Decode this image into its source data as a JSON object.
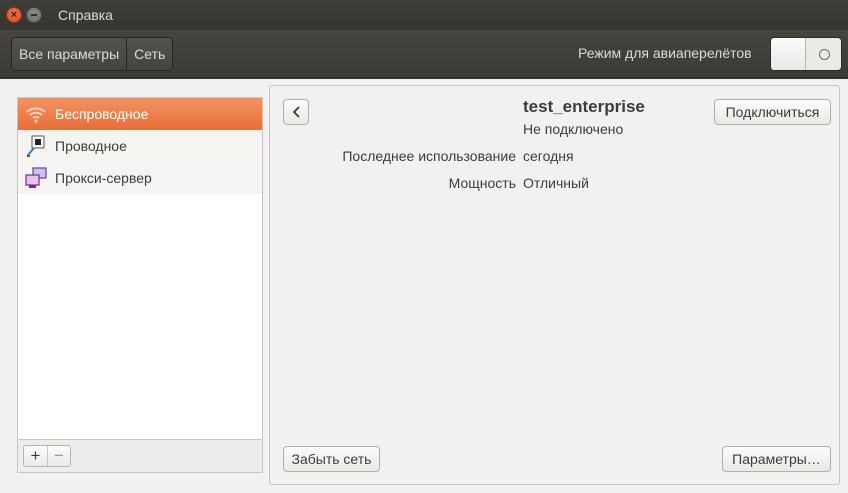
{
  "window": {
    "title": "Справка"
  },
  "toolbar": {
    "breadcrumbs": [
      "Все параметры",
      "Сеть"
    ],
    "airplane_mode_label": "Режим для авиаперелётов",
    "airplane_mode_on": false
  },
  "sidebar": {
    "items": [
      {
        "label": "Беспроводное",
        "icon": "wifi-icon",
        "selected": true
      },
      {
        "label": "Проводное",
        "icon": "wired-network-icon",
        "selected": false
      },
      {
        "label": "Прокси-сервер",
        "icon": "proxy-server-icon",
        "selected": false
      }
    ],
    "add_label": "+",
    "remove_label": "−"
  },
  "details": {
    "network_name": "test_enterprise",
    "status": "Не подключено",
    "connect_label": "Подключиться",
    "rows": [
      {
        "label": "Последнее использование",
        "value": "сегодня"
      },
      {
        "label": "Мощность",
        "value": "Отличный"
      }
    ],
    "forget_label": "Забыть сеть",
    "settings_label": "Параметры…"
  },
  "colors": {
    "accent": "#e96d39",
    "titlebar": "#3c3b37",
    "background": "#f2f1f0"
  }
}
